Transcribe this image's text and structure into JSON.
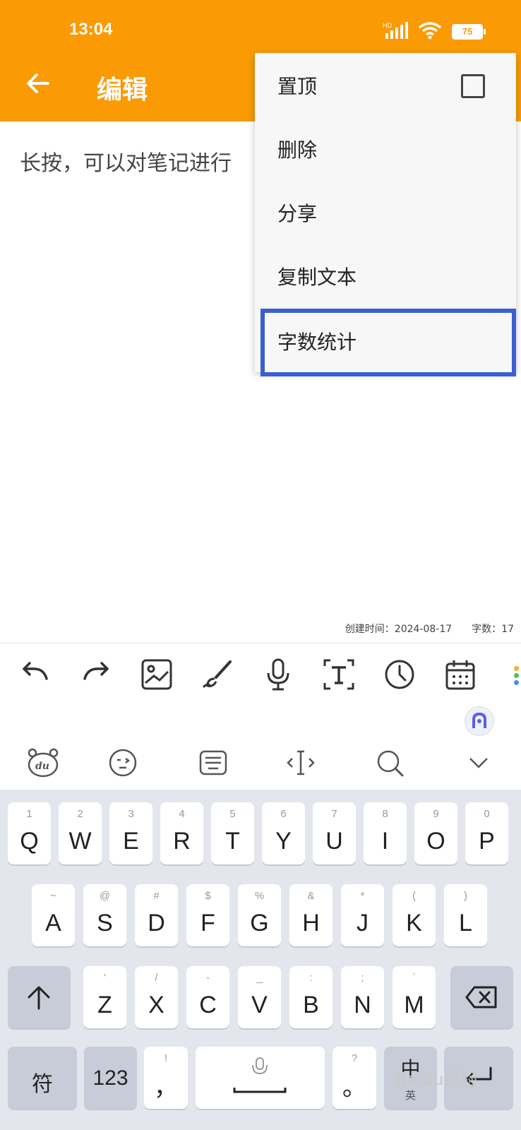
{
  "status_bar": {
    "time": "13:04",
    "network_label": "HD",
    "battery": "75"
  },
  "app_bar": {
    "title": "编辑",
    "back_icon": "back-arrow-icon"
  },
  "note": {
    "content": "长按，可以对笔记进行",
    "meta": "创建时间：2024-08-17　　字数：17"
  },
  "menu": {
    "items": [
      {
        "label": "置顶",
        "has_checkbox": true,
        "checked": false
      },
      {
        "label": "删除"
      },
      {
        "label": "分享"
      },
      {
        "label": "复制文本"
      },
      {
        "label": "字数统计",
        "highlighted": true
      }
    ],
    "highlight_color": "#3c5fd0"
  },
  "editor_toolbar": {
    "icons": [
      "undo-icon",
      "redo-icon",
      "image-icon",
      "brush-icon",
      "microphone-icon",
      "text-recognition-icon",
      "clock-icon",
      "calendar-icon"
    ]
  },
  "keyboard": {
    "top_icons": [
      "du-bear-icon",
      "emoji-icon",
      "keyboard-icon",
      "cursor-icon",
      "search-icon",
      "chevron-down-icon"
    ],
    "row1": [
      {
        "main": "Q",
        "sub": "1"
      },
      {
        "main": "W",
        "sub": "2"
      },
      {
        "main": "E",
        "sub": "3"
      },
      {
        "main": "R",
        "sub": "4"
      },
      {
        "main": "T",
        "sub": "5"
      },
      {
        "main": "Y",
        "sub": "6"
      },
      {
        "main": "U",
        "sub": "7"
      },
      {
        "main": "I",
        "sub": "8"
      },
      {
        "main": "O",
        "sub": "9"
      },
      {
        "main": "P",
        "sub": "0"
      }
    ],
    "row2": [
      {
        "main": "A",
        "sub": "~"
      },
      {
        "main": "S",
        "sub": "@"
      },
      {
        "main": "D",
        "sub": "#"
      },
      {
        "main": "F",
        "sub": "$"
      },
      {
        "main": "G",
        "sub": "%"
      },
      {
        "main": "H",
        "sub": "&"
      },
      {
        "main": "J",
        "sub": "*"
      },
      {
        "main": "K",
        "sub": "("
      },
      {
        "main": "L",
        "sub": ")"
      }
    ],
    "row3": [
      {
        "main": "Z",
        "sub": "'"
      },
      {
        "main": "X",
        "sub": "/"
      },
      {
        "main": "C",
        "sub": "-"
      },
      {
        "main": "V",
        "sub": "_"
      },
      {
        "main": "B",
        "sub": ":"
      },
      {
        "main": "N",
        "sub": ";"
      },
      {
        "main": "M",
        "sub": "`"
      }
    ],
    "symbols_key": "符",
    "numbers_key": "123",
    "comma_key": {
      "main": "，",
      "sub": "!"
    },
    "period_key": {
      "main": "。",
      "sub": "?"
    },
    "lang_key": {
      "main": "中",
      "sub": "英"
    }
  },
  "watermark": "Baidu经验"
}
